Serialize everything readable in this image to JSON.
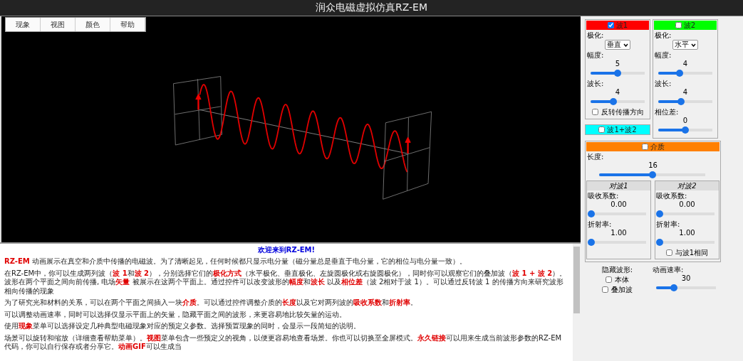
{
  "title": "润众电磁虚拟仿真RZ-EM",
  "menu": [
    "现象",
    "视图",
    "颜色",
    "帮助"
  ],
  "waves": [
    {
      "label": "波1",
      "checked": true,
      "color": "#ff0000",
      "polarization": {
        "label": "极化:",
        "value": "垂直"
      },
      "params": [
        {
          "label": "幅度:",
          "value": "5",
          "level": 0.5
        },
        {
          "label": "波长:",
          "value": "4",
          "level": 0.42
        }
      ],
      "option": {
        "label": "反转传播方向",
        "checked": false
      }
    },
    {
      "label": "波2",
      "checked": false,
      "color": "#00ff00",
      "polarization": {
        "label": "极化:",
        "value": "水平"
      },
      "params": [
        {
          "label": "幅度:",
          "value": "4",
          "level": 0.4
        },
        {
          "label": "波长:",
          "value": "4",
          "level": 0.42
        },
        {
          "label": "相位差:",
          "value": "0",
          "level": 0.5
        }
      ]
    }
  ],
  "superposition": {
    "label": "波1+波2",
    "checked": false
  },
  "medium": {
    "label": "介质",
    "checked": false,
    "length": {
      "label": "长度:",
      "value": "16",
      "level": 0.5
    },
    "sides": [
      {
        "title": "对波1",
        "params": [
          {
            "label": "吸收系数:",
            "value": "0.00",
            "level": 0
          },
          {
            "label": "折射率:",
            "value": "1.00",
            "level": 0
          }
        ]
      },
      {
        "title": "对波2",
        "params": [
          {
            "label": "吸收系数:",
            "value": "0.00",
            "level": 0
          },
          {
            "label": "折射率:",
            "value": "1.00",
            "level": 0
          }
        ],
        "option": {
          "label": "与波1相同",
          "checked": false
        }
      }
    ]
  },
  "hide_waveform": {
    "label": "隐藏波形:",
    "options": [
      {
        "label": "本体",
        "checked": false
      },
      {
        "label": "叠加波",
        "checked": false
      }
    ]
  },
  "animation_speed": {
    "label": "动画速率:",
    "value": "30",
    "level": 0.3
  },
  "intro": {
    "heading": "欢迎来到RZ-EM!",
    "paragraphs": [
      "**RZ-EM** 动画展示在真空和介质中传播的电磁波。为了清晰起见，任何时候都只显示电分量（磁分量总是垂直于电分量，它的相位与电分量一致）。",
      "在RZ-EM中，你可以生成两列波（**波 1**和**波 2**），分别选择它们的**极化方式**（水平极化、垂直极化、左旋圆极化或右旋圆极化），同时你可以观察它们的叠加波（**波 1 + 波 2**）。波形在两个平面之间向前传播, 电场**矢量** 被展示在这两个平面上。通过控件可以改变波形的**幅度**和**波长** 以及**相位差**（波 2相对于波 1）。可以通过反转波 1 的传播方向来研究波形相向传播的现象",
      "为了研究光和材料的关系，可以在两个平面之间插入一块**介质**。可以通过控件调整介质的**长度**以及它对两列波的**吸收系数**和**折射率**。",
      "可以调整动画速率，同时可以选择仅显示平面上的矢量，隐藏平面之间的波形，来更容易地比较矢量的运动。",
      "使用**现象**菜单可以选择设定几种典型电磁现象对应的预定义参数。选择预置现象的同时，会显示一段简短的说明。",
      "场景可以旋转和缩放（详细查看帮助菜单）。**视图**菜单包含一些预定义的视角，以便更容易地查看场景。你也可以切换至全屏模式。**永久链接**可以用来生成当前波形参数的RZ-EM代码，你可以自行保存或者分享它。**动画GIF**可以生成当"
    ]
  }
}
